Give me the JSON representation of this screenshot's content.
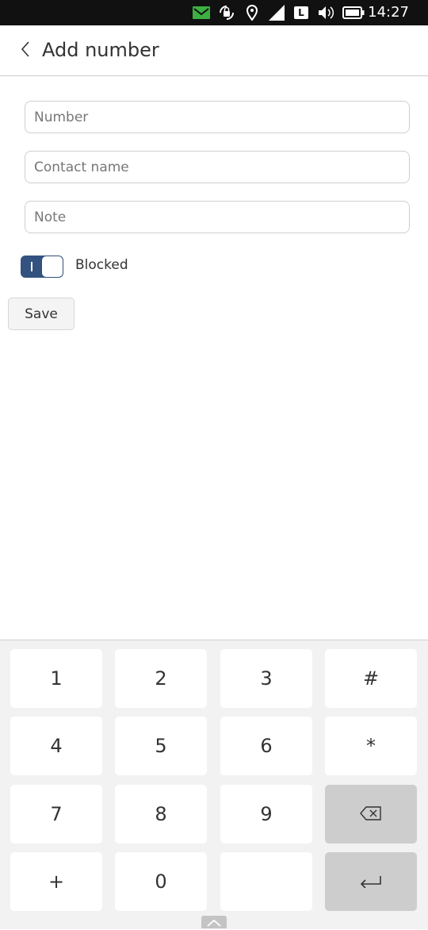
{
  "status_bar": {
    "time": "14:27",
    "icons": [
      "message-icon",
      "rotation-lock-icon",
      "location-icon",
      "signal-icon",
      "lte-icon",
      "volume-icon",
      "battery-icon"
    ],
    "network_label": "L",
    "message_color": "#3cb043"
  },
  "header": {
    "back_icon": "chevron-left-icon",
    "title": "Add number"
  },
  "form": {
    "number_placeholder": "Number",
    "contact_placeholder": "Contact name",
    "note_placeholder": "Note",
    "blocked_label": "Blocked",
    "blocked_on": true,
    "toggle_color": "#335280",
    "save_label": "Save"
  },
  "keyboard": {
    "keys": [
      "1",
      "2",
      "3",
      "#",
      "4",
      "5",
      "6",
      "*",
      "7",
      "8",
      "9",
      "",
      "+",
      "0",
      "",
      ""
    ],
    "backspace_icon": "backspace-icon",
    "enter_icon": "enter-icon",
    "hide_icon": "chevron-up-icon"
  }
}
